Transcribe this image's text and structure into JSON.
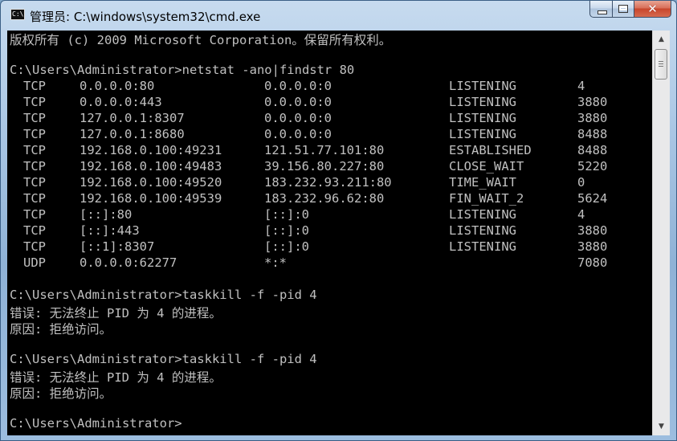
{
  "window": {
    "title": "管理员: C:\\windows\\system32\\cmd.exe",
    "icon_text": "C:\\"
  },
  "console": {
    "before": [
      "版权所有 (c) 2009 Microsoft Corporation。保留所有权利。",
      "",
      "C:\\Users\\Administrator>netstat -ano|findstr 80"
    ],
    "netstat_rows": [
      [
        "TCP",
        "0.0.0.0:80",
        "0.0.0.0:0",
        "LISTENING",
        "4"
      ],
      [
        "TCP",
        "0.0.0.0:443",
        "0.0.0.0:0",
        "LISTENING",
        "3880"
      ],
      [
        "TCP",
        "127.0.0.1:8307",
        "0.0.0.0:0",
        "LISTENING",
        "3880"
      ],
      [
        "TCP",
        "127.0.0.1:8680",
        "0.0.0.0:0",
        "LISTENING",
        "8488"
      ],
      [
        "TCP",
        "192.168.0.100:49231",
        "121.51.77.101:80",
        "ESTABLISHED",
        "8488"
      ],
      [
        "TCP",
        "192.168.0.100:49483",
        "39.156.80.227:80",
        "CLOSE_WAIT",
        "5220"
      ],
      [
        "TCP",
        "192.168.0.100:49520",
        "183.232.93.211:80",
        "TIME_WAIT",
        "0"
      ],
      [
        "TCP",
        "192.168.0.100:49539",
        "183.232.96.62:80",
        "FIN_WAIT_2",
        "5624"
      ],
      [
        "TCP",
        "[::]:80",
        "[::]:0",
        "LISTENING",
        "4"
      ],
      [
        "TCP",
        "[::]:443",
        "[::]:0",
        "LISTENING",
        "3880"
      ],
      [
        "TCP",
        "[::1]:8307",
        "[::]:0",
        "LISTENING",
        "3880"
      ],
      [
        "UDP",
        "0.0.0.0:62277",
        "*:*",
        "",
        "7080"
      ]
    ],
    "after": [
      "",
      "C:\\Users\\Administrator>taskkill -f -pid 4",
      "错误: 无法终止 PID 为 4 的进程。",
      "原因: 拒绝访问。",
      "",
      "C:\\Users\\Administrator>taskkill -f -pid 4",
      "错误: 无法终止 PID 为 4 的进程。",
      "原因: 拒绝访问。",
      "",
      "C:\\Users\\Administrator>"
    ]
  },
  "scrollbar": {
    "up_icon": "triangle-up-icon",
    "down_icon": "triangle-down-icon",
    "level": 0.0
  }
}
